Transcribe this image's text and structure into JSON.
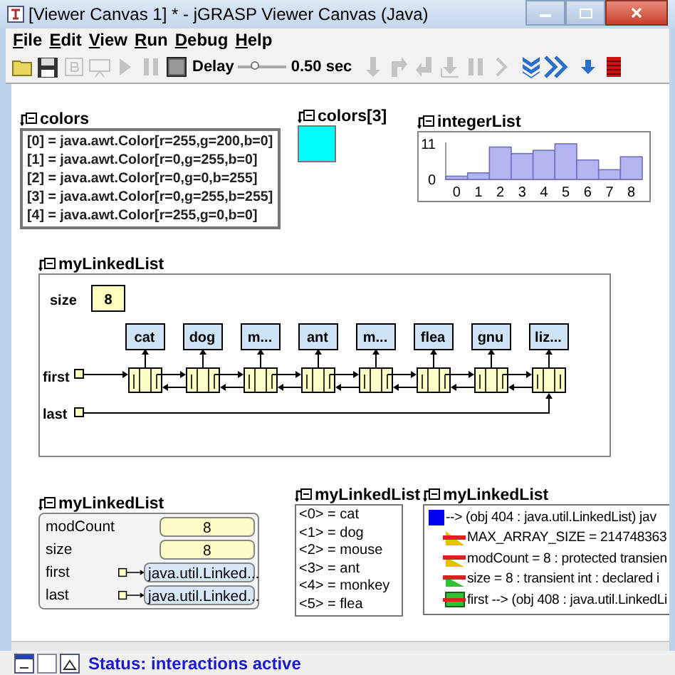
{
  "window": {
    "title": "[Viewer Canvas 1] * - jGRASP Viewer Canvas (Java)"
  },
  "menu": [
    {
      "label": "File"
    },
    {
      "label": "Edit"
    },
    {
      "label": "View"
    },
    {
      "label": "Run"
    },
    {
      "label": "Debug"
    },
    {
      "label": "Help"
    }
  ],
  "toolbar": [
    {
      "kind": "open",
      "disabled": false
    },
    {
      "kind": "save",
      "disabled": false
    },
    {
      "kind": "build",
      "disabled": true
    },
    {
      "kind": "record",
      "disabled": true
    },
    {
      "kind": "play",
      "disabled": true
    },
    {
      "kind": "pause",
      "disabled": true
    },
    {
      "kind": "stop",
      "disabled": false
    },
    {
      "kind": "slider",
      "label": "Delay",
      "level": 0.35,
      "reading": "0.50 sec"
    },
    {
      "kind": "stepover",
      "disabled": true
    },
    {
      "kind": "stepin",
      "disabled": true
    },
    {
      "kind": "stepout",
      "disabled": true
    },
    {
      "kind": "tocursor",
      "disabled": true
    },
    {
      "kind": "pause",
      "disabled": true
    },
    {
      "kind": "resume",
      "disabled": true
    },
    {
      "kind": "autostep",
      "disabled": false
    },
    {
      "kind": "fastforward",
      "disabled": false
    },
    {
      "kind": "down",
      "disabled": false
    },
    {
      "kind": "terminate",
      "disabled": false
    }
  ],
  "canvas": {
    "widgets": [
      {
        "kind": "array",
        "label": "colors",
        "items": [
          "[0] = java.awt.Color[r=255,g=200,b=0]",
          "[1] = java.awt.Color[r=0,g=255,b=0]",
          "[2] = java.awt.Color[r=0,g=0,b=255]",
          "[3] = java.awt.Color[r=0,g=255,b=255]",
          "[4] = java.awt.Color[r=255,g=0,b=0]"
        ]
      },
      {
        "kind": "swatch",
        "label": "colors[3]",
        "color": "#00ffff"
      },
      {
        "kind": "chart",
        "label": "integerList",
        "chart_data": {
          "type": "bar",
          "categories": [
            "0",
            "1",
            "2",
            "3",
            "4",
            "5",
            "6",
            "7",
            "8"
          ],
          "values": [
            1,
            2,
            10,
            8,
            9,
            11,
            6,
            3,
            7
          ],
          "ylim": [
            0,
            11
          ],
          "yticks": [
            0,
            11
          ]
        }
      },
      {
        "kind": "linkedlist",
        "label": "myLinkedList",
        "size_label": "size",
        "size": "8",
        "nodes": [
          "cat",
          "dog",
          "m...",
          "ant",
          "m...",
          "flea",
          "gnu",
          "liz..."
        ],
        "first_label": "first",
        "last_label": "last"
      },
      {
        "kind": "fields",
        "label": "myLinkedList",
        "rows": [
          {
            "kind": "primitive",
            "name": "modCount",
            "value": "8"
          },
          {
            "kind": "primitive",
            "name": "size",
            "value": "8"
          },
          {
            "kind": "reference",
            "name": "first",
            "value": "java.util.Linked..."
          },
          {
            "kind": "reference",
            "name": "last",
            "value": "java.util.Linked..."
          }
        ]
      },
      {
        "kind": "list",
        "label": "myLinkedList",
        "items": [
          "<0> = cat",
          "<1> = dog",
          "<2> = mouse",
          "<3> = ant",
          "<4> = monkey",
          "<5> = flea"
        ]
      },
      {
        "kind": "tree",
        "label": "myLinkedList",
        "rows": [
          {
            "kind": "object",
            "text": "--> (obj 404 : java.util.LinkedList) jav"
          },
          {
            "kind": "constant",
            "text": "MAX_ARRAY_SIZE = 214748363"
          },
          {
            "kind": "protected",
            "text": "modCount = 8 : protected transien"
          },
          {
            "kind": "field",
            "text": "size = 8 : transient int : declared i"
          },
          {
            "kind": "reference",
            "text": "first --> (obj 408 : java.util.LinkedLi"
          }
        ]
      }
    ]
  },
  "status_bar": {
    "text": "Status: interactions active"
  }
}
